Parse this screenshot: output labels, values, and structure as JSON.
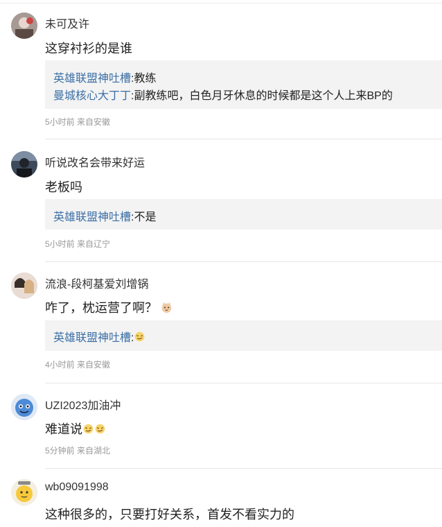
{
  "comments": [
    {
      "username": "未可及许",
      "text": "这穿衬衫的是谁",
      "replies": [
        {
          "name": "英雄联盟神吐槽",
          "sep": ":",
          "text": "教练"
        },
        {
          "name": "曼城核心大丁丁",
          "sep": ":",
          "text": "副教练吧，白色月牙休息的时候都是这个人上来BP的"
        }
      ],
      "meta": "5小时前 来自安徽"
    },
    {
      "username": "听说改名会带来好运",
      "text": "老板吗",
      "replies": [
        {
          "name": "英雄联盟神吐槽",
          "sep": ":",
          "text": "不是"
        }
      ],
      "meta": "5小时前 来自辽宁"
    },
    {
      "username": "流浪-段柯基爱刘增锅",
      "text": "咋了，枕运营了啊？",
      "emoji": "cat-face-emoji",
      "replies": [
        {
          "name": "英雄联盟神吐槽",
          "sep": ":",
          "text": "",
          "emoji": "sly-face-emoji"
        }
      ],
      "meta": "4小时前 来自安徽"
    },
    {
      "username": "UZI2023加油冲",
      "text": "难道说",
      "emojis": [
        "sly-face-emoji",
        "sly-face-emoji"
      ],
      "meta": "5分钟前 来自湖北"
    },
    {
      "username": "wb09091998",
      "text": "这种很多的，只要打好关系，首发不看实力的"
    }
  ]
}
